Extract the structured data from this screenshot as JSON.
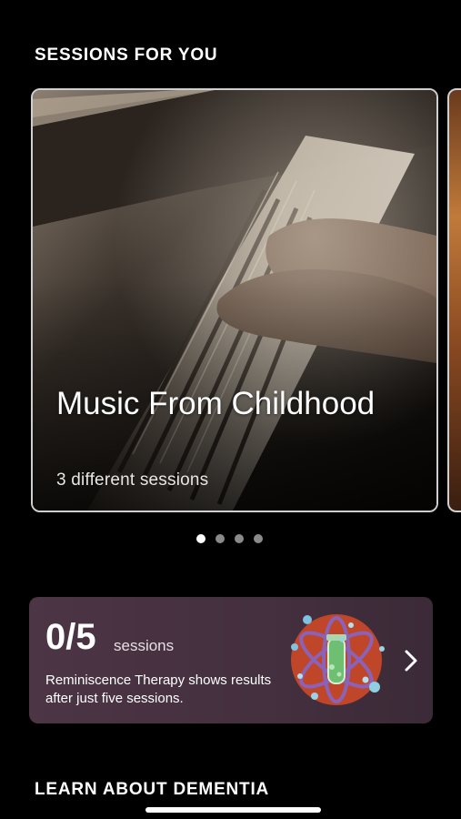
{
  "sections": {
    "sessions_title": "SESSIONS FOR YOU",
    "learn_title": "LEARN ABOUT DEMENTIA"
  },
  "carousel": {
    "active_index": 0,
    "total": 4,
    "cards": [
      {
        "title": "Music From Childhood",
        "subtitle": "3 different sessions",
        "image": "piano-hands-photo"
      }
    ]
  },
  "progress": {
    "count": "0/5",
    "unit": "sessions",
    "description": "Reminiscence Therapy shows results after just five sessions.",
    "icon": "atom-test-tube-icon",
    "chevron_icon": "chevron-right-icon"
  },
  "colors": {
    "background": "#000000",
    "card_border": "#cfcfcf",
    "progress_card": "#45303f",
    "icon_circle": "#c0462a"
  }
}
